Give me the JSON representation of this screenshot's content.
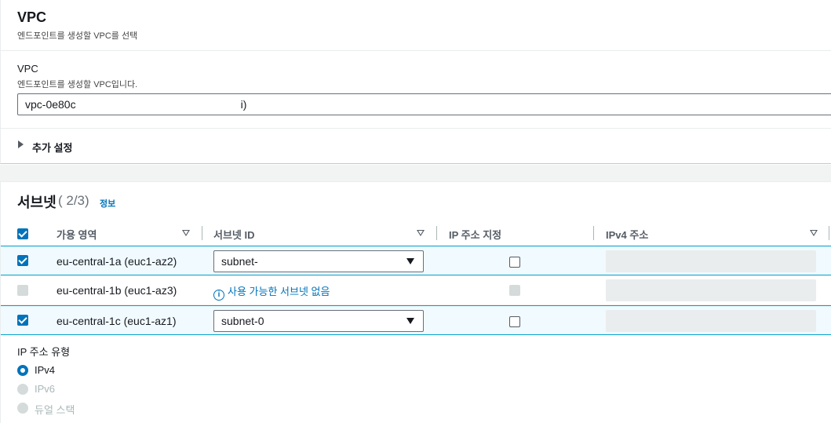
{
  "vpc_panel": {
    "title": "VPC",
    "description": "엔드포인트를 생성할 VPC를 선택",
    "field_label": "VPC",
    "field_description": "엔드포인트를 생성할 VPC입니다.",
    "selected_vpc_prefix": "vpc-0e80c",
    "selected_vpc_suffix": "i)",
    "additional_settings": "추가 설정"
  },
  "subnets_panel": {
    "title": "서브넷",
    "count": "( 2/3)",
    "info_link": "정보",
    "columns": [
      "가용 영역",
      "서브넷 ID",
      "IP 주소 지정",
      "IPv4 주소"
    ],
    "rows": [
      {
        "az": "eu-central-1a (euc1-az2)",
        "subnet": "subnet-",
        "checked": true
      },
      {
        "az": "eu-central-1b (euc1-az3)",
        "no_subnet": "사용 가능한 서브넷 없음",
        "checked": false
      },
      {
        "az": "eu-central-1c (euc1-az1)",
        "subnet": "subnet-0",
        "checked": true
      }
    ],
    "ip_type_label": "IP 주소 유형",
    "ip_types": [
      "IPv4",
      "IPv6",
      "듀얼 스택"
    ],
    "selected_ip_type": "IPv4"
  },
  "colors": {
    "accent": "#0073bb",
    "selected_row_bg": "#f1faff",
    "selected_border": "#00a1c9"
  },
  "icons": [
    "caret-right-icon",
    "sort-icon",
    "info-icon",
    "dropdown-caret-icon"
  ]
}
